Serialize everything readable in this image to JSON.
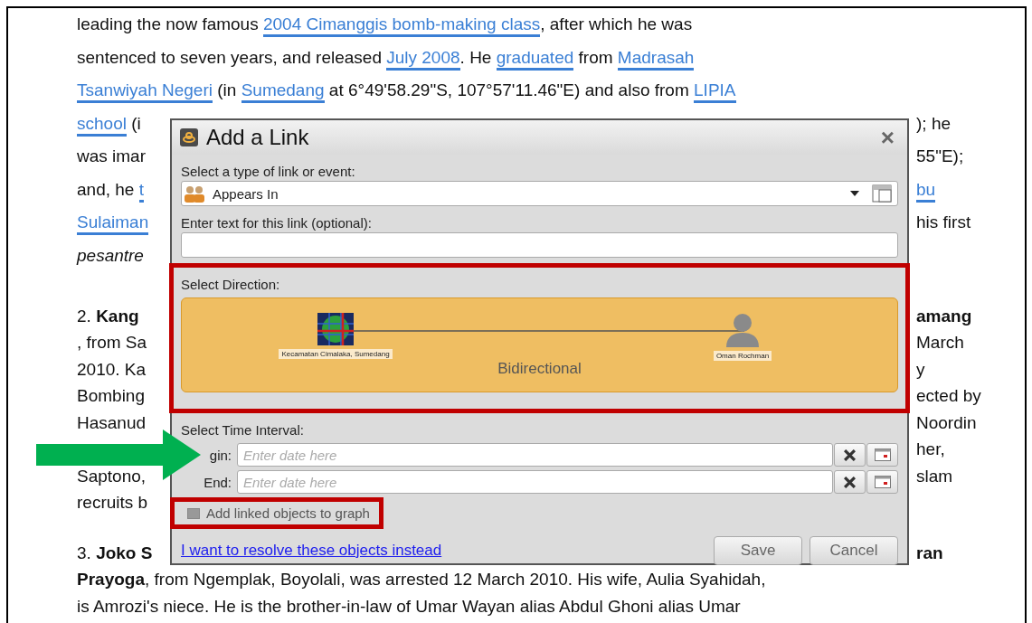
{
  "article": {
    "paragraphs": [
      {
        "lines": [
          {
            "left": [
              {
                "kind": "plain",
                "text": "leading the now famous "
              },
              {
                "kind": "link",
                "text": "2004 Cimanggis bomb-making class"
              },
              {
                "kind": "plain",
                "text": ", after which he was"
              }
            ]
          },
          {
            "left": [
              {
                "kind": "plain",
                "text": "sentenced to seven years, and released "
              },
              {
                "kind": "link",
                "text": "July 2008"
              },
              {
                "kind": "plain",
                "text": ". He "
              },
              {
                "kind": "link",
                "text": "graduated"
              },
              {
                "kind": "plain",
                "text": " from "
              },
              {
                "kind": "link",
                "text": "Madrasah"
              }
            ]
          },
          {
            "left": [
              {
                "kind": "link",
                "text": "Tsanwiyah Negeri"
              },
              {
                "kind": "plain",
                "text": " (in "
              },
              {
                "kind": "link",
                "text": "Sumedang"
              },
              {
                "kind": "plain",
                "text": " at 6°49'58.29\"S, 107°57'11.46\"E) and also from "
              },
              {
                "kind": "link",
                "text": "LIPIA"
              }
            ]
          },
          {
            "left": [
              {
                "kind": "link",
                "text": "school"
              },
              {
                "kind": "plain",
                "text": " (i"
              }
            ],
            "right": [
              {
                "kind": "plain",
                "text": "); he"
              }
            ]
          },
          {
            "left": [
              {
                "kind": "plain",
                "text": "was imar"
              }
            ],
            "right": [
              {
                "kind": "plain",
                "text": "55\"E);"
              }
            ]
          },
          {
            "left": [
              {
                "kind": "plain",
                "text": "and, he "
              },
              {
                "kind": "link",
                "text": "t"
              }
            ],
            "right": [
              {
                "kind": "link",
                "text": "bu"
              }
            ]
          },
          {
            "left": [
              {
                "kind": "link",
                "text": "Sulaiman"
              }
            ],
            "right": [
              {
                "kind": "plain",
                "text": "his first"
              }
            ]
          },
          {
            "left": [
              {
                "kind": "italic",
                "text": "pesantre"
              }
            ]
          }
        ]
      },
      {
        "lines": [
          {
            "left": [
              {
                "kind": "plain",
                "text": "2. "
              },
              {
                "kind": "bold",
                "text": "Kang"
              }
            ],
            "right": [
              {
                "kind": "bold",
                "text": "amang"
              }
            ]
          },
          {
            "left": [
              {
                "kind": "plain",
                "text": ", from Sa"
              }
            ],
            "right": [
              {
                "kind": "plain",
                "text": "March"
              }
            ]
          },
          {
            "left": [
              {
                "kind": "plain",
                "text": "2010. Ka"
              }
            ],
            "right": [
              {
                "kind": "plain",
                "text": "y"
              }
            ]
          },
          {
            "left": [
              {
                "kind": "plain",
                "text": "Bombing"
              }
            ],
            "right": [
              {
                "kind": "plain",
                "text": "ected by"
              }
            ]
          },
          {
            "left": [
              {
                "kind": "plain",
                "text": "Hasanud"
              }
            ],
            "right": [
              {
                "kind": "plain",
                "text": "Noordin"
              }
            ]
          },
          {
            "right": [
              {
                "kind": "plain",
                "text": "her,"
              }
            ]
          },
          {
            "left": [
              {
                "kind": "plain",
                "text": "Saptono,"
              }
            ],
            "right": [
              {
                "kind": "plain",
                "text": "slam"
              }
            ]
          },
          {
            "left": [
              {
                "kind": "plain",
                "text": "recruits b"
              }
            ]
          }
        ]
      },
      {
        "lines": [
          {
            "left": [
              {
                "kind": "plain",
                "text": "3. "
              },
              {
                "kind": "bold",
                "text": "Joko S"
              }
            ],
            "right": [
              {
                "kind": "bold",
                "text": "ran"
              }
            ]
          },
          {
            "left": [
              {
                "kind": "bold",
                "text": "Prayoga"
              },
              {
                "kind": "plain",
                "text": ", from Ngemplak, Boyolali, was arrested 12 March 2010. His wife, Aulia Syahidah,"
              }
            ]
          },
          {
            "left": [
              {
                "kind": "plain",
                "text": "is Amrozi's niece. He is the brother-in-law of Umar Wayan alias Abdul Ghoni alias Umar"
              }
            ]
          }
        ]
      }
    ]
  },
  "dialog": {
    "title": "Add a Link",
    "close": "×",
    "type_label": "Select a type of link or event:",
    "type_value": "Appears In",
    "text_label": "Enter text for this link (optional):",
    "direction": {
      "label": "Select Direction:",
      "highlighted": true,
      "from": "Kecamatan Cimalaka, Sumedang",
      "to": "Oman Rochman",
      "mode": "Bidirectional"
    },
    "time": {
      "label": "Select Time Interval:",
      "fields": [
        {
          "label": "gin:",
          "placeholder": "Enter date here",
          "pointed": true
        },
        {
          "label": "End:",
          "placeholder": "Enter date here",
          "pointed": false
        }
      ]
    },
    "add_objects": {
      "label": "Add linked objects to graph",
      "checked": false,
      "highlighted": true
    },
    "resolve_link": "I want to resolve these objects instead",
    "buttons": [
      "Save",
      "Cancel"
    ]
  }
}
